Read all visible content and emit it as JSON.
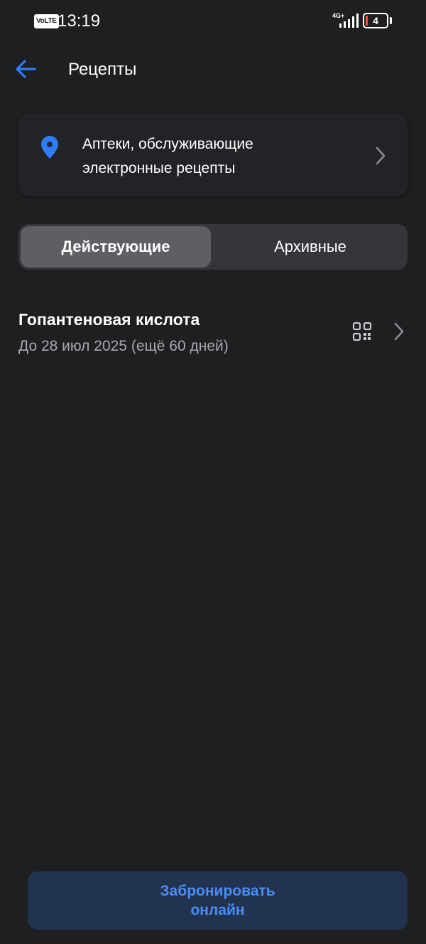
{
  "status_bar": {
    "volte": "VoLTE",
    "time": "13:19",
    "network": "4G+",
    "battery": "4"
  },
  "header": {
    "title": "Рецепты"
  },
  "pharmacy_card": {
    "line1": "Аптеки, обслуживающие",
    "line2": "электронные рецепты"
  },
  "tabs": [
    {
      "label": "Действующие",
      "active": true
    },
    {
      "label": "Архивные",
      "active": false
    }
  ],
  "recipes": [
    {
      "name": "Гопантеновая кислота",
      "date": "До 28 июл 2025 (ещё 60 дней)"
    }
  ],
  "actions": {
    "book_line1": "Забронировать",
    "book_line2": "онлайн"
  },
  "colors": {
    "background": "#1e1f21",
    "accent": "#2f7cf6",
    "button_bg": "#223350",
    "battery_low": "#ff4b3a"
  }
}
